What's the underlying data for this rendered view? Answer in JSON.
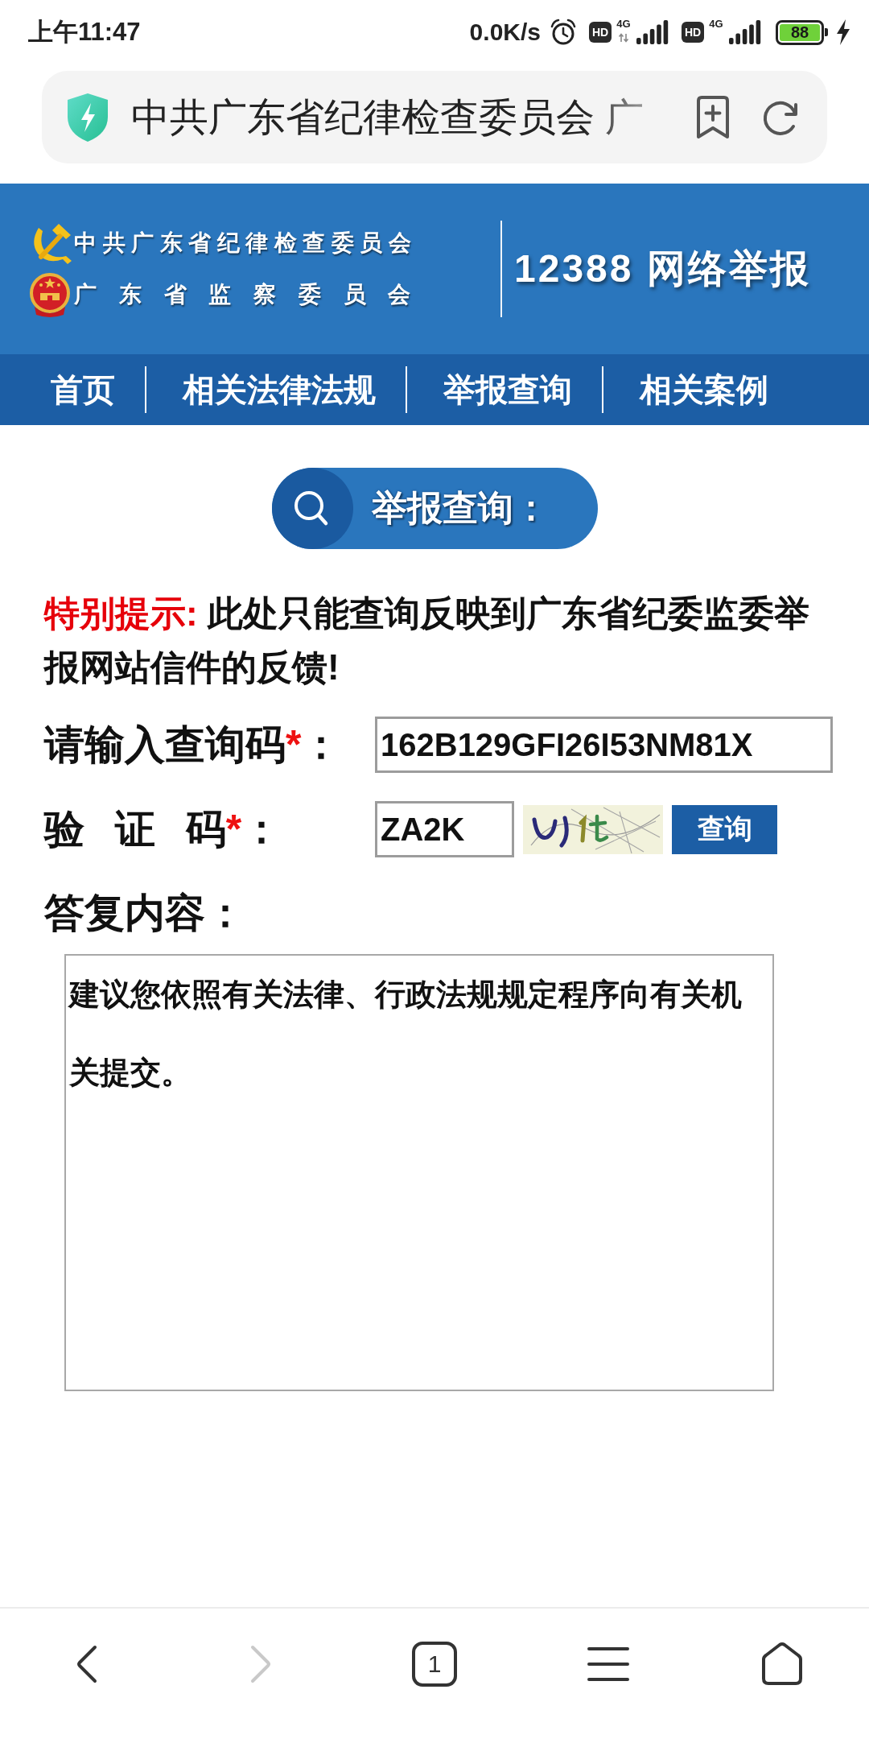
{
  "status_bar": {
    "time": "上午11:47",
    "net_speed": "0.0K/s",
    "sims": [
      {
        "badge": "HD",
        "network": "4G",
        "data_active": true
      },
      {
        "badge": "HD",
        "network": "4G",
        "data_active": false
      }
    ],
    "battery": "88",
    "charging": true
  },
  "browser_bar": {
    "page_title": "中共广东省纪律检查委员会 广"
  },
  "site_header": {
    "org_lines": [
      {
        "kind": "party",
        "text": "中共广东省纪律检查委员会"
      },
      {
        "kind": "government",
        "text": "广 东 省 监 察 委 员 会"
      }
    ],
    "title": "12388 网络举报"
  },
  "nav": [
    {
      "label": "首页"
    },
    {
      "label": "相关法律法规"
    },
    {
      "label": "举报查询"
    },
    {
      "label": "相关案例"
    }
  ],
  "section_title": "举报查询：",
  "notice": {
    "label": "特别提示:",
    "text": "此处只能查询反映到广东省纪委监委举报网站信件的反馈!"
  },
  "form": {
    "fields": [
      {
        "kind": "code",
        "label": "请输入查询码",
        "required_mark": "*",
        "suffix": "：",
        "value": "162B129GFI26I53NM81X"
      },
      {
        "kind": "captcha",
        "label": "验 证 码",
        "required_mark": "*",
        "suffix": "：",
        "value": "ZA2K",
        "button": "查询"
      }
    ],
    "reply": {
      "label": "答复内容：",
      "text": "建议您依照有关法律、行政法规规定程序向有关机关提交。"
    }
  },
  "bottom_bar": [
    {
      "kind": "back",
      "disabled": false
    },
    {
      "kind": "forward",
      "disabled": true
    },
    {
      "kind": "tabs",
      "count": "1"
    },
    {
      "kind": "menu"
    },
    {
      "kind": "home"
    }
  ]
}
